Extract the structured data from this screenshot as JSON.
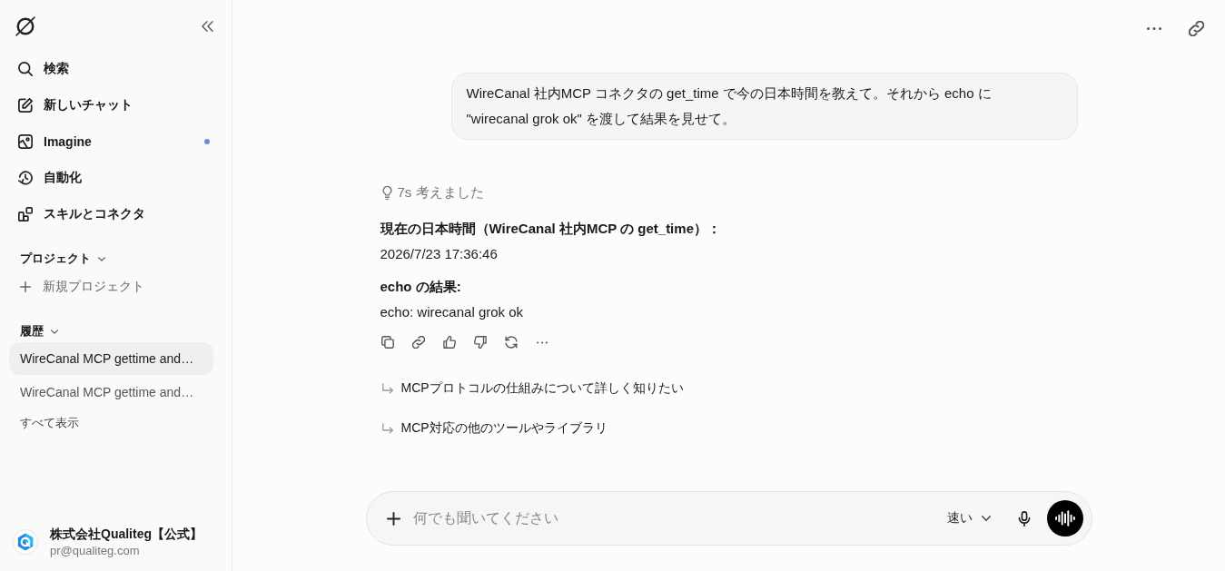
{
  "sidebar": {
    "nav_items": [
      {
        "label": "検索",
        "dot": false
      },
      {
        "label": "新しいチャット",
        "dot": false
      },
      {
        "label": "Imagine",
        "dot": true
      },
      {
        "label": "自動化",
        "dot": false
      },
      {
        "label": "スキルとコネクタ",
        "dot": false
      }
    ],
    "projects": {
      "heading": "プロジェクト",
      "new_project": "新規プロジェクト"
    },
    "history": {
      "heading": "履歴",
      "items": [
        {
          "title": "WireCanal MCP gettime and…",
          "selected": true
        },
        {
          "title": "WireCanal MCP gettime and…",
          "selected": false
        }
      ],
      "show_all": "すべて表示"
    },
    "account": {
      "name": "株式会社Qualiteg【公式】",
      "email": "pr@qualiteg.com"
    }
  },
  "conversation": {
    "user_message": "WireCanal 社内MCP コネクタの get_time で今の日本時間を教えて。それから echo に \"wirecanal grok ok\" を渡して結果を見せて。",
    "thought": "7s 考えました",
    "response": [
      {
        "kind": "heading",
        "text": "現在の日本時間（WireCanal 社内MCP の get_time）："
      },
      {
        "kind": "text",
        "text": "2026/7/23 17:36:46"
      },
      {
        "kind": "heading",
        "text": "echo の結果:"
      },
      {
        "kind": "text",
        "text": "echo: wirecanal grok ok"
      }
    ],
    "suggestions": [
      "MCPプロトコルの仕組みについて詳しく知りたい",
      "MCP対応の他のツールやライブラリ"
    ]
  },
  "composer": {
    "placeholder": "何でも聞いてください",
    "mode": "速い"
  }
}
